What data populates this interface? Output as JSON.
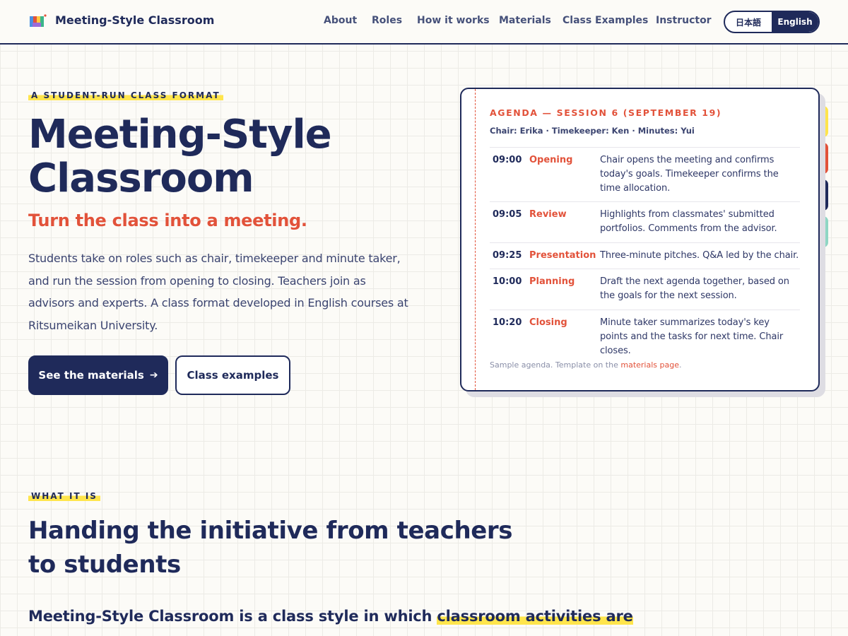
{
  "header": {
    "brand": "Meeting-Style Classroom",
    "nav": [
      {
        "label": "About"
      },
      {
        "label": "Roles"
      },
      {
        "label": "How it works"
      },
      {
        "label": "Materials"
      },
      {
        "label": "Class Examples"
      },
      {
        "label": "Instructor"
      }
    ],
    "lang": {
      "ja": "日本語",
      "en": "English",
      "active": "en"
    }
  },
  "hero": {
    "eyebrow": "A STUDENT-RUN CLASS FORMAT",
    "title": "Meeting-Style Classroom",
    "tagline": "Turn the class into a meeting.",
    "body": "Students take on roles such as chair, timekeeper and minute taker, and run the session from opening to closing. Teachers join as advisors and experts. A class format developed in English courses at Ritsumeikan University.",
    "primary_button": "See the materials",
    "secondary_button": "Class examples"
  },
  "agenda_card": {
    "title": "AGENDA — SESSION 6 (SEPTEMBER 19)",
    "roles": "Chair: Erika · Timekeeper: Ken · Minutes: Yui",
    "rows": [
      {
        "time": "09:00",
        "item": "Opening",
        "desc": "Chair opens the meeting and confirms today's goals. Timekeeper confirms the time allocation."
      },
      {
        "time": "09:05",
        "item": "Review",
        "desc": "Highlights from classmates' submitted portfolios. Comments from the advisor."
      },
      {
        "time": "09:25",
        "item": "Presentation",
        "desc": "Three-minute pitches. Q&A led by the chair."
      },
      {
        "time": "10:00",
        "item": "Planning",
        "desc": "Draft the next agenda together, based on the goals for the next session."
      },
      {
        "time": "10:20",
        "item": "Closing",
        "desc": "Minute taker summarizes today's key points and the tasks for next time. Chair closes."
      }
    ],
    "note_prefix": "Sample agenda. Template on the ",
    "note_link": "materials page",
    "note_suffix": ".",
    "tab_colors": [
      "#ffe54c",
      "#e2523a",
      "#1f2a5a",
      "#8fd6c4"
    ]
  },
  "what_it_is": {
    "eyebrow": "WHAT IT IS",
    "title": "Handing the initiative from teachers to students",
    "lead_plain": "Meeting-Style Classroom is a class style in which ",
    "lead_highlight": "classroom activities are"
  },
  "colors": {
    "navy": "#1f2a5a",
    "accent": "#e2523a",
    "highlight": "#ffe54c",
    "mint": "#8fd6c4"
  }
}
